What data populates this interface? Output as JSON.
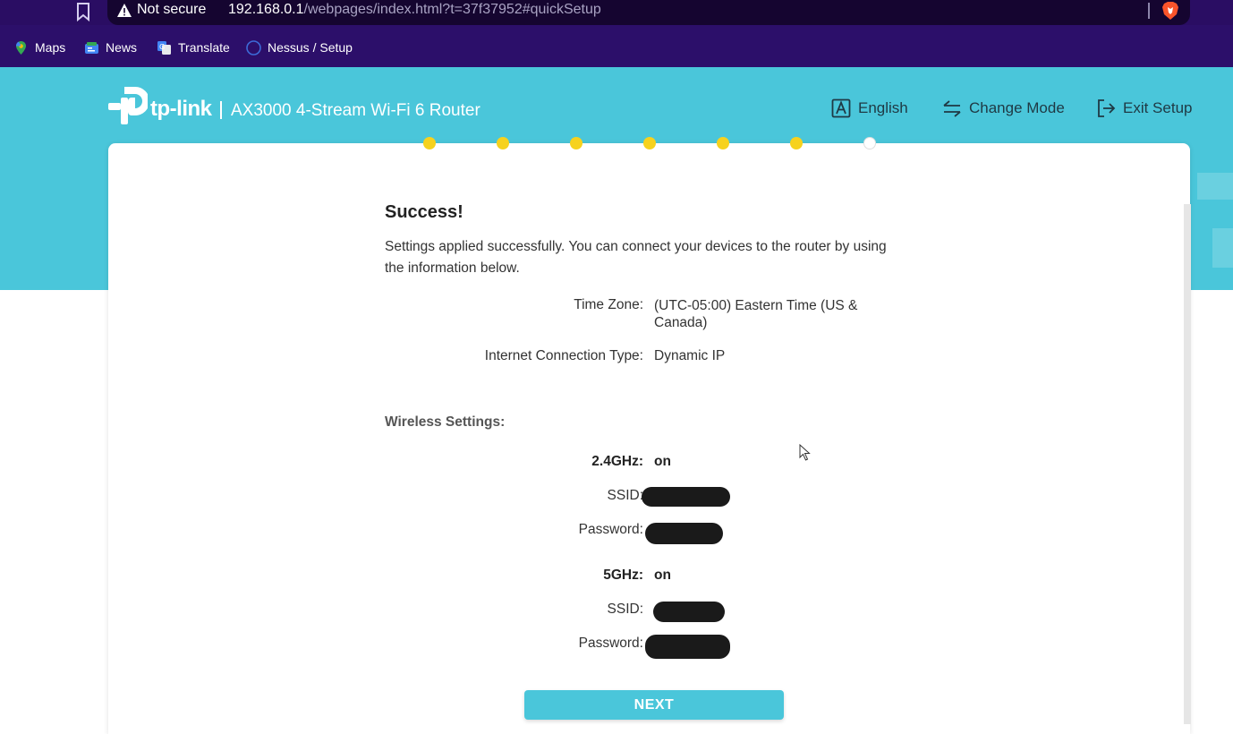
{
  "browser": {
    "security_label": "Not secure",
    "url_host": "192.168.0.1",
    "url_path": "/webpages/index.html?t=37f37952#quickSetup",
    "icons": [
      "bookmark-icon",
      "warning-icon",
      "brave-icon"
    ],
    "bookmarks": [
      {
        "label": "Maps",
        "icon": "maps-icon"
      },
      {
        "label": "News",
        "icon": "news-icon"
      },
      {
        "label": "Translate",
        "icon": "translate-icon"
      },
      {
        "label": "Nessus / Setup",
        "icon": "globe-icon"
      }
    ]
  },
  "header": {
    "logo_text": "tp-link",
    "product_name": "AX3000 4-Stream Wi-Fi 6 Router",
    "language_label": "English",
    "change_mode_label": "Change Mode",
    "exit_label": "Exit Setup"
  },
  "progress": {
    "total_steps": 7,
    "completed_steps": 6
  },
  "summary": {
    "title": "Success!",
    "intro": "Settings applied successfully. You can connect your devices to the router by using the information below.",
    "time_zone_label": "Time Zone:",
    "time_zone_value": "(UTC-05:00) Eastern Time (US & Canada)",
    "connection_type_label": "Internet Connection Type:",
    "connection_type_value": "Dynamic IP",
    "wireless_title": "Wireless Settings:",
    "band_24": {
      "label": "2.4GHz:",
      "status": "on",
      "ssid_label": "SSID:",
      "password_label": "Password:"
    },
    "band_5": {
      "label": "5GHz:",
      "status": "on",
      "ssid_label": "SSID:",
      "password_label": "Password:"
    }
  },
  "actions": {
    "next_label": "NEXT"
  },
  "colors": {
    "accent": "#4ac6da",
    "step_done": "#f6d21e",
    "browser_bar": "#2c0f6a"
  }
}
